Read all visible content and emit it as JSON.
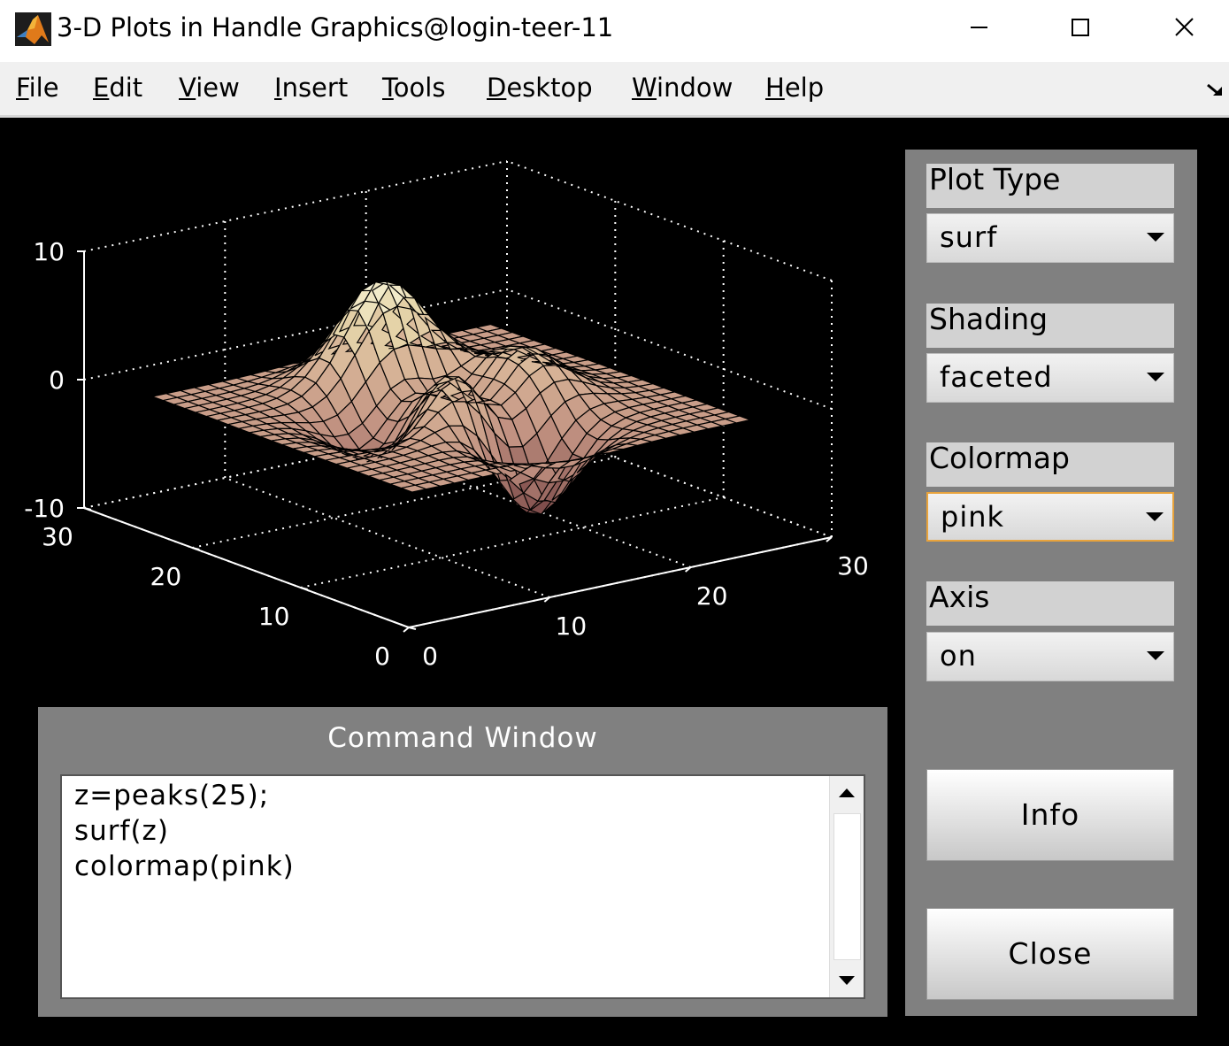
{
  "window": {
    "title": "3-D Plots in Handle Graphics@login-teer-11",
    "controls": [
      "minimize-icon",
      "maximize-icon",
      "close-icon"
    ]
  },
  "menubar": {
    "items": [
      "File",
      "Edit",
      "View",
      "Insert",
      "Tools",
      "Desktop",
      "Window",
      "Help"
    ],
    "dock_icon": "dock-arrow-icon"
  },
  "controls": {
    "plot_type": {
      "label": "Plot Type",
      "value": "surf"
    },
    "shading": {
      "label": "Shading",
      "value": "faceted"
    },
    "colormap": {
      "label": "Colormap",
      "value": "pink"
    },
    "axis": {
      "label": "Axis",
      "value": "on"
    },
    "info_button": "Info",
    "close_button": "Close"
  },
  "command_window": {
    "title": "Command Window",
    "lines": [
      "z=peaks(25);",
      "surf(z)",
      "colormap(pink)"
    ]
  },
  "colors": {
    "figure_bg": "#000000",
    "panel_bg": "#808080",
    "label_bg": "#d2d2d2",
    "focus_border": "#e8a33c",
    "surface_low": "#c09080",
    "surface_high": "#f4f0c8"
  },
  "chart_data": {
    "type": "surface",
    "function": "peaks(25)",
    "grid_size": 25,
    "colormap": "pink",
    "shading": "faceted",
    "xlim": [
      0,
      30
    ],
    "ylim": [
      0,
      30
    ],
    "zlim": [
      -10,
      10
    ],
    "x_ticks": [
      "0",
      "10",
      "20",
      "30"
    ],
    "y_ticks": [
      "0",
      "10",
      "20",
      "30"
    ],
    "z_ticks": [
      "-10",
      "0",
      "10"
    ],
    "grid": true
  }
}
